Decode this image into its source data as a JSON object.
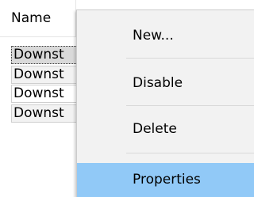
{
  "list": {
    "column_header": "Name",
    "rows": [
      "Downst",
      "Downst",
      "Downst",
      "Downst"
    ]
  },
  "context_menu": {
    "items": [
      "New...",
      "Disable",
      "Delete",
      "Properties"
    ],
    "highlighted": "Properties"
  },
  "colors": {
    "highlight": "#91c9f7",
    "menu_background": "#f2f2f2"
  }
}
